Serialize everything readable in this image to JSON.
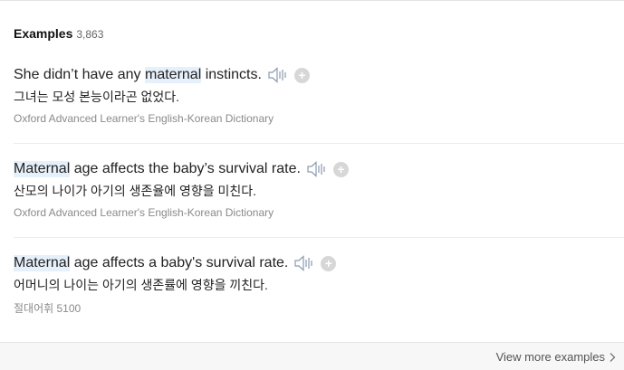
{
  "header": {
    "title": "Examples",
    "count": "3,863"
  },
  "examples": [
    {
      "highlight": "maternal",
      "before": "She didn’t have any ",
      "after": " instincts.",
      "translation": "그녀는 모성 본능이라곤 없었다.",
      "source": "Oxford Advanced Learner's English-Korean Dictionary"
    },
    {
      "highlight": "Maternal",
      "before": "",
      "after": " age affects the baby’s survival rate.",
      "translation": "산모의 나이가 아기의 생존율에 영향을 미친다.",
      "source": "Oxford Advanced Learner's English-Korean Dictionary"
    },
    {
      "highlight": "Maternal",
      "before": "",
      "after": " age affects a baby's survival rate.",
      "translation": "어머니의 나이는 아기의 생존률에 영향을 끼친다.",
      "source": "절대어휘 5100"
    }
  ],
  "icons": {
    "speaker": "speaker-icon",
    "add": "plus-icon",
    "more": "chevron-right-icon"
  },
  "footer": {
    "view_more_label": "View more examples"
  },
  "colors": {
    "highlight_bg": "#e6f0fa",
    "icon_gray": "#d7d7d7",
    "speaker_stroke": "#8a9bb0"
  }
}
